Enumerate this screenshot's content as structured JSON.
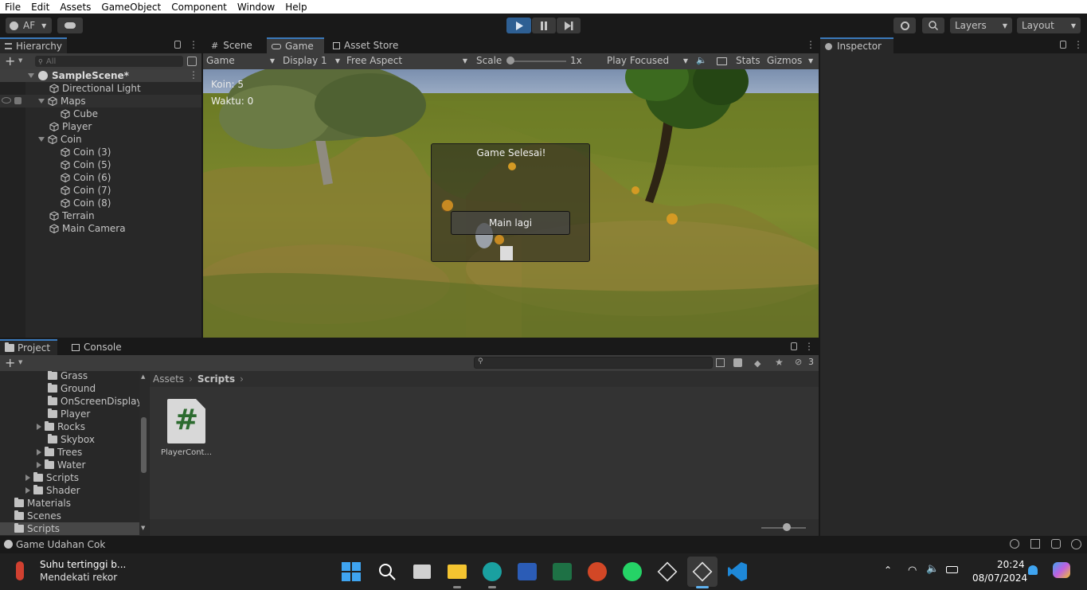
{
  "menubar": {
    "items": [
      "File",
      "Edit",
      "Assets",
      "GameObject",
      "Component",
      "Window",
      "Help"
    ]
  },
  "toolbar": {
    "account": "AF",
    "layers": "Layers",
    "layout": "Layout"
  },
  "hierarchy": {
    "tab": "Hierarchy",
    "search_placeholder": "All",
    "scene": "SampleScene*",
    "items": [
      {
        "label": "Directional Light"
      },
      {
        "label": "Maps"
      },
      {
        "label": "Cube"
      },
      {
        "label": "Player"
      },
      {
        "label": "Coin"
      },
      {
        "label": "Coin (3)"
      },
      {
        "label": "Coin (5)"
      },
      {
        "label": "Coin (6)"
      },
      {
        "label": "Coin (7)"
      },
      {
        "label": "Coin (8)"
      },
      {
        "label": "Terrain"
      },
      {
        "label": "Main Camera"
      }
    ]
  },
  "view": {
    "tabs": [
      "Scene",
      "Game",
      "Asset Store"
    ],
    "game_dropdown": "Game",
    "display": "Display 1",
    "aspect": "Free Aspect",
    "scale_label": "Scale",
    "scale_value": "1x",
    "play_mode": "Play Focused",
    "stats": "Stats",
    "gizmos": "Gizmos"
  },
  "game": {
    "koin": "Koin: 5",
    "waktu": "Waktu: 0",
    "dialog_title": "Game Selesai!",
    "dialog_button": "Main lagi"
  },
  "inspector": {
    "tab": "Inspector"
  },
  "project": {
    "tabs": [
      "Project",
      "Console"
    ],
    "hidden_count": "3",
    "breadcrumb": [
      "Assets",
      "Scripts"
    ],
    "tree": [
      {
        "label": "Grass"
      },
      {
        "label": "Ground"
      },
      {
        "label": "OnScreenDisplay"
      },
      {
        "label": "Player"
      },
      {
        "label": "Rocks"
      },
      {
        "label": "Skybox"
      },
      {
        "label": "Trees"
      },
      {
        "label": "Water"
      },
      {
        "label": "Scripts"
      },
      {
        "label": "Shader"
      },
      {
        "label": "Materials"
      },
      {
        "label": "Scenes"
      },
      {
        "label": "Scripts"
      }
    ],
    "asset_label": "PlayerCont..."
  },
  "status": {
    "message": "Game Udahan Cok"
  },
  "taskbar": {
    "weather_title": "Suhu tertinggi b...",
    "weather_sub": "Mendekati rekor",
    "time": "20:24",
    "date": "08/07/2024"
  },
  "colors": {
    "accent": "#3a79bb",
    "play_active": "#2e5f93",
    "csharp_green": "#2c6b2f"
  }
}
